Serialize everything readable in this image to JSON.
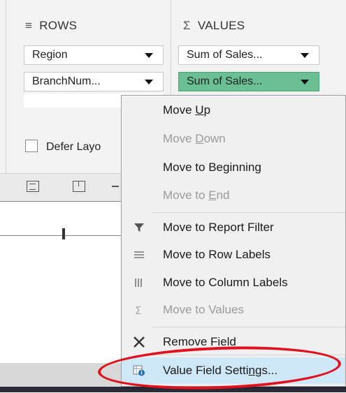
{
  "rows_area": {
    "header": "ROWS",
    "header_icon": "rows-icon",
    "fields": [
      {
        "label": "Region"
      },
      {
        "label": "BranchNum..."
      }
    ]
  },
  "values_area": {
    "header": "VALUES",
    "header_icon": "sigma-icon",
    "fields": [
      {
        "label": "Sum of Sales..."
      },
      {
        "label": "Sum of Sales...",
        "selected": true
      }
    ]
  },
  "defer": {
    "label": "Defer Layo"
  },
  "context_menu": {
    "items": [
      {
        "pre": "Move ",
        "key": "U",
        "post": "p",
        "enabled": true,
        "icon": ""
      },
      {
        "pre": "Move ",
        "key": "D",
        "post": "own",
        "enabled": false,
        "icon": ""
      },
      {
        "pre": "Move to Be",
        "key": "g",
        "post": "inning",
        "enabled": true,
        "icon": ""
      },
      {
        "pre": "Move to ",
        "key": "E",
        "post": "nd",
        "enabled": false,
        "icon": ""
      },
      {
        "pre": "Move to Report Filter",
        "key": "",
        "post": "",
        "enabled": true,
        "icon": "filter-icon"
      },
      {
        "pre": "Move to Row Labels",
        "key": "",
        "post": "",
        "enabled": true,
        "icon": "rows-icon"
      },
      {
        "pre": "Move to Column Labels",
        "key": "",
        "post": "",
        "enabled": true,
        "icon": "columns-icon"
      },
      {
        "pre": "Move to Values",
        "key": "",
        "post": "",
        "enabled": false,
        "icon": "sigma-icon"
      },
      {
        "pre": "Remove Field",
        "key": "",
        "post": "",
        "enabled": true,
        "icon": "remove-x-icon"
      },
      {
        "pre": "Value Field Setti",
        "key": "n",
        "post": "gs...",
        "enabled": true,
        "icon": "field-settings-icon",
        "highlighted": true
      }
    ]
  },
  "annotation": {
    "color": "#e0121f"
  },
  "colors": {
    "selected_field": "#6bbf95",
    "menu_bg": "#f0f0f0",
    "disabled_text": "#9a9a9a"
  }
}
